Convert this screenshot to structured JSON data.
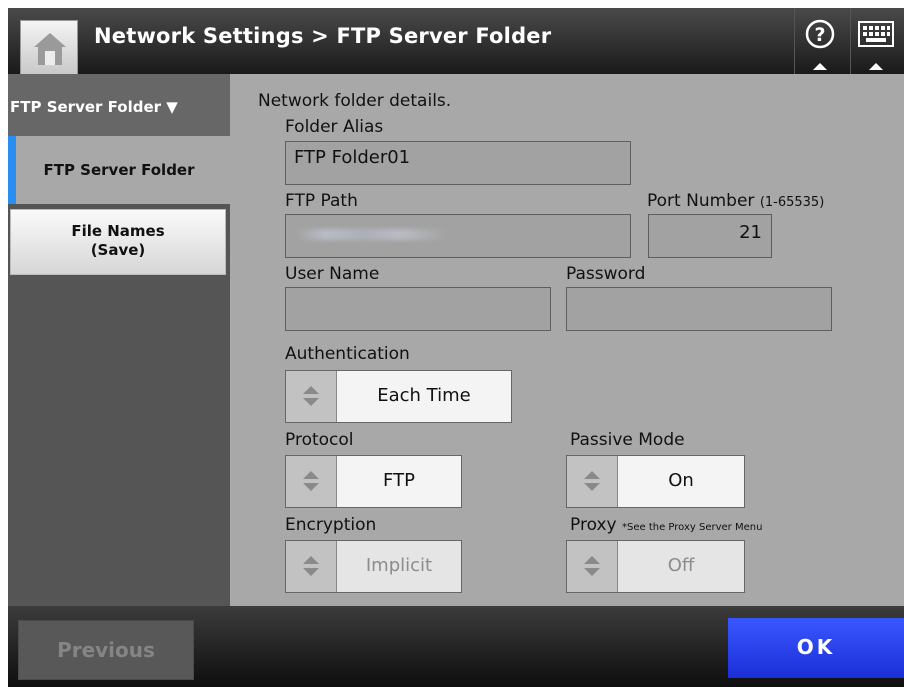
{
  "header": {
    "title": "Network Settings > FTP Server Folder",
    "home_icon": "home-icon",
    "help_icon": "help-icon",
    "keyboard_icon": "keyboard-icon"
  },
  "sidebar": {
    "heading": "FTP Server Folder ▼",
    "items": [
      {
        "label": "FTP Server Folder",
        "active": true
      },
      {
        "label_line1": "File Names",
        "label_line2": "(Save)",
        "active": false
      }
    ],
    "accent_color": "#2a8df0"
  },
  "form": {
    "description": "Network folder details.",
    "folder_alias_label": "Folder Alias",
    "folder_alias_value": "FTP Folder01",
    "ftp_path_label": "FTP Path",
    "port_label": "Port Number",
    "port_range": "(1-65535)",
    "port_value": "21",
    "user_name_label": "User Name",
    "user_name_value": "",
    "password_label": "Password",
    "password_value": "",
    "authentication_label": "Authentication",
    "authentication_value": "Each Time",
    "protocol_label": "Protocol",
    "protocol_value": "FTP",
    "passive_mode_label": "Passive Mode",
    "passive_mode_value": "On",
    "encryption_label": "Encryption",
    "encryption_value": "Implicit",
    "proxy_label": "Proxy",
    "proxy_note": "*See the Proxy Server Menu",
    "proxy_value": "Off"
  },
  "footer": {
    "previous_label": "Previous",
    "ok_label": "OK",
    "ok_color": "#2a44f0"
  }
}
